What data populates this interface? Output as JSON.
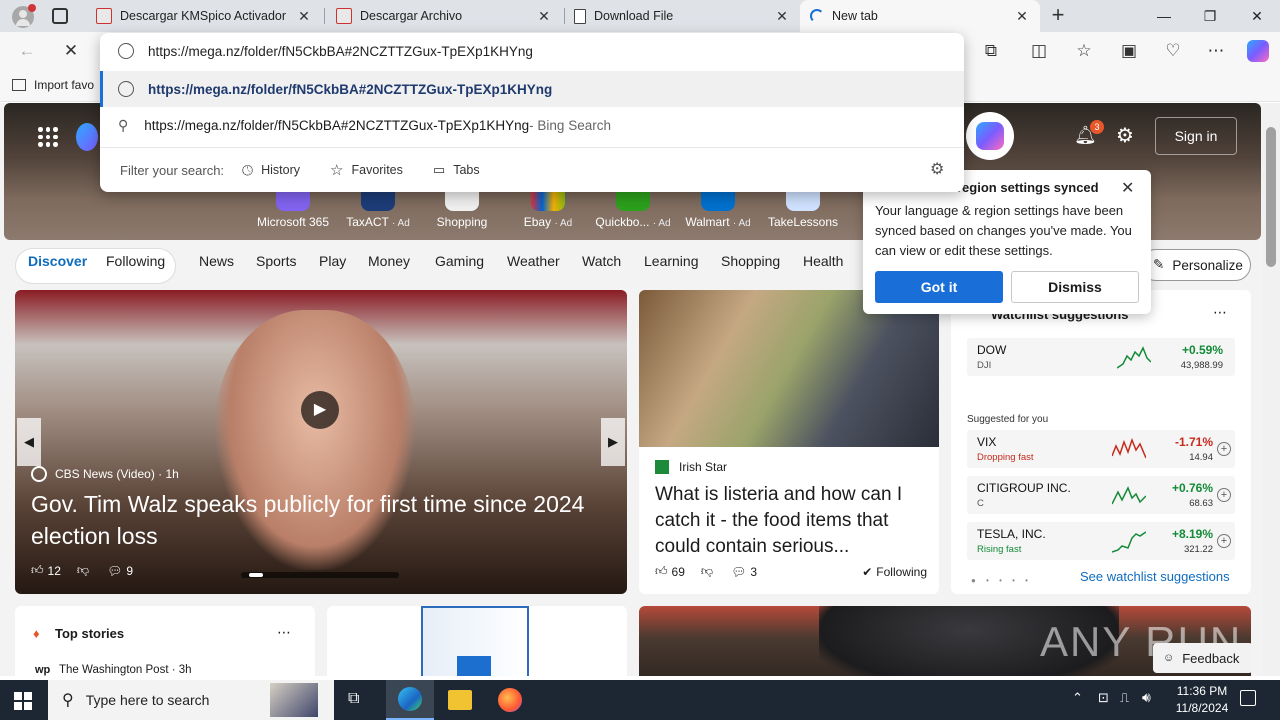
{
  "tabs": [
    {
      "title": "Descargar KMSpico Activador"
    },
    {
      "title": "Descargar Archivo"
    },
    {
      "title": "Download File"
    },
    {
      "title": "New tab"
    }
  ],
  "address_bar": {
    "value": "https://mega.nz/folder/fN5CkbBA#2NCZTTZGux-TpEXp1KHYng"
  },
  "suggestions": {
    "url_suggestion": "https://mega.nz/folder/fN5CkbBA#2NCZTTZGux-TpEXp1KHYng",
    "search_suggestion": "https://mega.nz/folder/fN5CkbBA#2NCZTTZGux-TpEXp1KHYng",
    "search_engine_suffix": " - Bing Search",
    "filter_label": "Filter your search:",
    "filters": [
      "History",
      "Favorites",
      "Tabs"
    ]
  },
  "favbar": {
    "import_label": "Import favo"
  },
  "header": {
    "notification_count": "3",
    "sign_in": "Sign in"
  },
  "quick_links": [
    {
      "label": "Microsoft 365",
      "ad": ""
    },
    {
      "label": "TaxACT",
      "ad": "· Ad"
    },
    {
      "label": "Shopping",
      "ad": ""
    },
    {
      "label": "Ebay",
      "ad": "· Ad"
    },
    {
      "label": "Quickbo...",
      "ad": "· Ad"
    },
    {
      "label": "Walmart",
      "ad": "· Ad"
    },
    {
      "label": "TakeLessons",
      "ad": ""
    }
  ],
  "sync_popup": {
    "title": "region settings synced",
    "body": "Your language & region settings have been synced based on changes you've made. You can view or edit these settings.",
    "got_it": "Got it",
    "dismiss": "Dismiss"
  },
  "nav": {
    "items": [
      "Discover",
      "Following",
      "News",
      "Sports",
      "Play",
      "Money",
      "Gaming",
      "Weather",
      "Watch",
      "Learning",
      "Shopping",
      "Health"
    ],
    "personalize": "Personalize"
  },
  "main_story": {
    "source": "CBS News (Video)",
    "age": "· 1h",
    "title": "Gov. Tim Walz speaks publicly for first time since 2024 election loss",
    "likes": "12",
    "comments": "9"
  },
  "side_story": {
    "source": "Irish Star",
    "title": "What is listeria and how can I catch it - the food items that could contain serious...",
    "likes": "69",
    "comments": "3",
    "following": "Following"
  },
  "watchlist": {
    "title": "Watchlist suggestions",
    "top": {
      "name": "DOW",
      "symbol": "DJI",
      "change": "+0.59%",
      "value": "43,988.99"
    },
    "suggested_label": "Suggested for you",
    "items": [
      {
        "name": "VIX",
        "sub": "Dropping fast",
        "change": "-1.71%",
        "value": "14.94"
      },
      {
        "name": "CITIGROUP INC.",
        "sub": "C",
        "change": "+0.76%",
        "value": "68.63"
      },
      {
        "name": "TESLA, INC.",
        "sub": "Rising fast",
        "change": "+8.19%",
        "value": "321.22"
      }
    ],
    "see_more": "See watchlist suggestions"
  },
  "top_stories": {
    "title": "Top stories",
    "source": "The Washington Post · 3h"
  },
  "feedback": "Feedback",
  "watermark": "ANY RUN",
  "taskbar": {
    "search_placeholder": "Type here to search",
    "time": "11:36 PM",
    "date": "11/8/2024"
  },
  "colors": {
    "accent": "#1a6ed8",
    "link": "#0f6cbd",
    "positive": "#138a36",
    "negative": "#c42b1c"
  }
}
